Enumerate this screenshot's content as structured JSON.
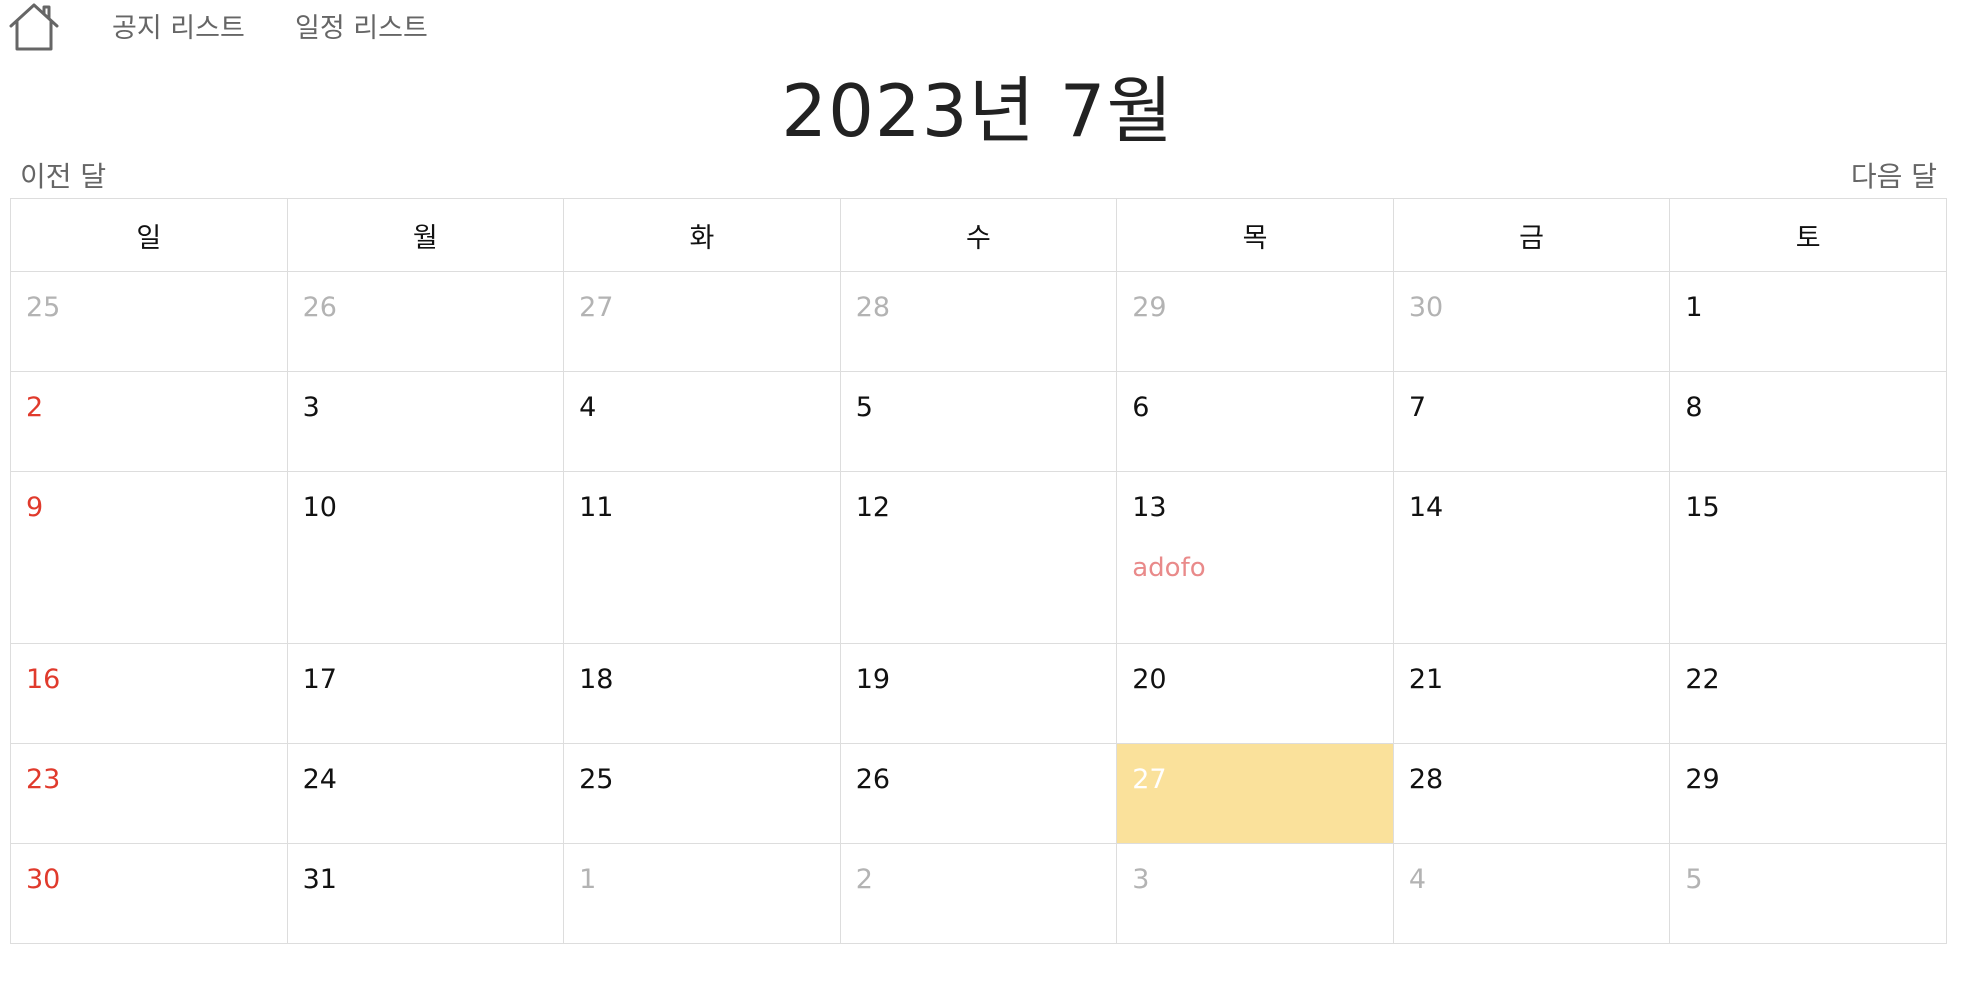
{
  "nav": {
    "home_icon": "home-icon",
    "notice_list": "공지 리스트",
    "schedule_list": "일정 리스트"
  },
  "calendar": {
    "title": "2023년 7월",
    "prev_label": "이전 달",
    "next_label": "다음 달",
    "weekdays": [
      "일",
      "월",
      "화",
      "수",
      "목",
      "금",
      "토"
    ],
    "weeks": [
      [
        {
          "day": "25",
          "other": true
        },
        {
          "day": "26",
          "other": true
        },
        {
          "day": "27",
          "other": true
        },
        {
          "day": "28",
          "other": true
        },
        {
          "day": "29",
          "other": true
        },
        {
          "day": "30",
          "other": true
        },
        {
          "day": "1"
        }
      ],
      [
        {
          "day": "2"
        },
        {
          "day": "3"
        },
        {
          "day": "4"
        },
        {
          "day": "5"
        },
        {
          "day": "6"
        },
        {
          "day": "7"
        },
        {
          "day": "8"
        }
      ],
      [
        {
          "day": "9"
        },
        {
          "day": "10"
        },
        {
          "day": "11"
        },
        {
          "day": "12"
        },
        {
          "day": "13",
          "event": "adofo"
        },
        {
          "day": "14"
        },
        {
          "day": "15"
        }
      ],
      [
        {
          "day": "16"
        },
        {
          "day": "17"
        },
        {
          "day": "18"
        },
        {
          "day": "19"
        },
        {
          "day": "20"
        },
        {
          "day": "21"
        },
        {
          "day": "22"
        }
      ],
      [
        {
          "day": "23"
        },
        {
          "day": "24"
        },
        {
          "day": "25"
        },
        {
          "day": "26"
        },
        {
          "day": "27",
          "today": true
        },
        {
          "day": "28"
        },
        {
          "day": "29"
        }
      ],
      [
        {
          "day": "30"
        },
        {
          "day": "31"
        },
        {
          "day": "1",
          "other": true
        },
        {
          "day": "2",
          "other": true
        },
        {
          "day": "3",
          "other": true
        },
        {
          "day": "4",
          "other": true
        },
        {
          "day": "5",
          "other": true
        }
      ]
    ]
  },
  "colors": {
    "sunday": "#e03a2c",
    "other_month": "#b3b3b3",
    "today_bg": "#fae19b",
    "event": "#e98a8a"
  }
}
